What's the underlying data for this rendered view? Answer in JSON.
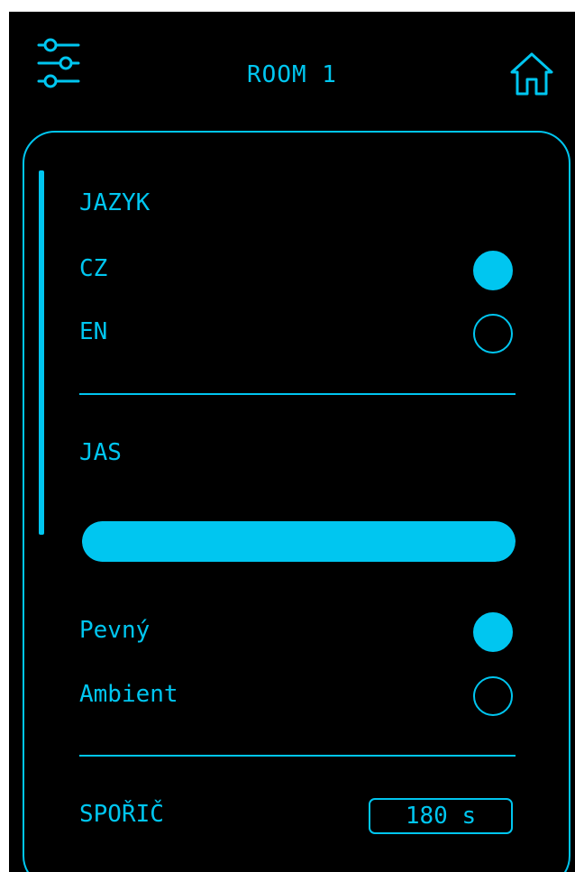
{
  "header": {
    "title": "ROOM 1",
    "left_icon": "settings-sliders-icon",
    "right_icon": "home-icon"
  },
  "language": {
    "heading": "JAZYK",
    "options": [
      {
        "label": "CZ",
        "selected": true
      },
      {
        "label": "EN",
        "selected": false
      }
    ]
  },
  "brightness": {
    "heading": "JAS",
    "level_percent": 100,
    "modes": [
      {
        "label": "Pevný",
        "selected": true
      },
      {
        "label": "Ambient",
        "selected": false
      }
    ]
  },
  "screensaver": {
    "label": "SPOŘIČ",
    "value": "180 s"
  },
  "colors": {
    "accent": "#00c6f0",
    "background": "#000000"
  }
}
